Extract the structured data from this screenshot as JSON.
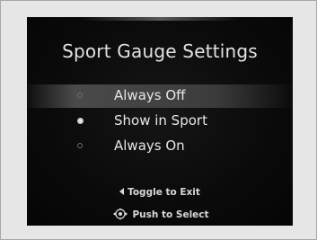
{
  "screen": {
    "title": "Sport Gauge Settings",
    "options": [
      {
        "label": "Always Off",
        "selected": false,
        "highlighted": true
      },
      {
        "label": "Show in Sport",
        "selected": true,
        "highlighted": false
      },
      {
        "label": "Always On",
        "selected": false,
        "highlighted": false
      }
    ],
    "hints": {
      "toggle": "Toggle to Exit",
      "push": "Push to Select",
      "toggle_icon": "triangle-left-icon",
      "push_icon": "selector-dial-icon"
    }
  },
  "colors": {
    "screen_bg": "#0b0b0b",
    "text": "#e6e6e6",
    "highlight": "#4a4a4a",
    "frame_bg": "#e6e6e6"
  }
}
